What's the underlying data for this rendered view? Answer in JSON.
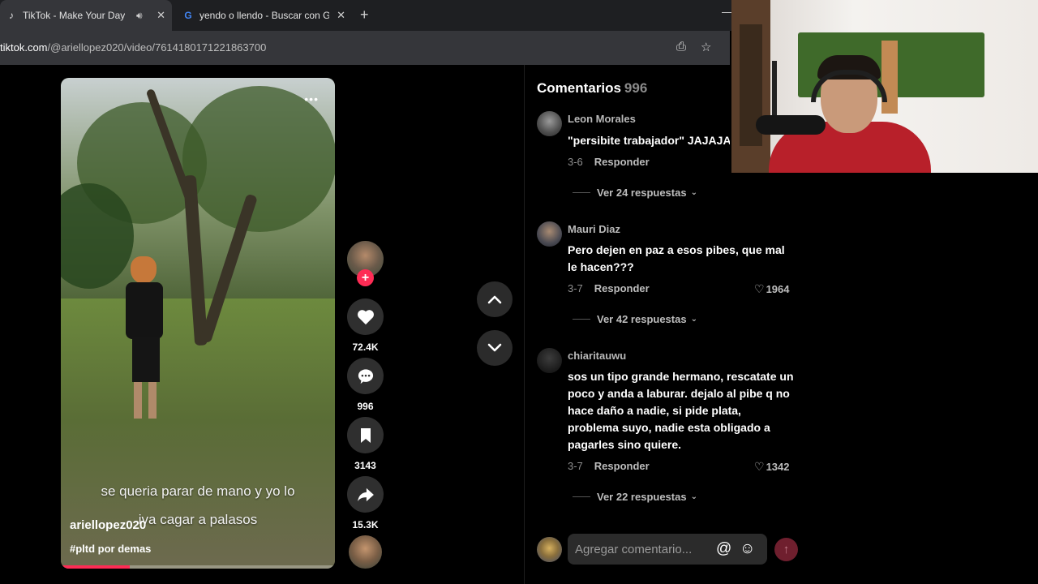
{
  "browser": {
    "tabs": [
      {
        "title": "TikTok - Make Your Day",
        "icon": "tiktok-icon"
      },
      {
        "title": "yendo o llendo - Buscar con Go",
        "icon": "google-icon"
      }
    ],
    "url_host": "tiktok.com",
    "url_path": "/@ariellopez020/video/7614180171221863700"
  },
  "video": {
    "caption_line1": "se queria parar de mano y yo lo",
    "caption_line2": "iva cagar a palasos",
    "username": "ariellopez020",
    "hashtag": "#pltd por demas",
    "progress": 0.25
  },
  "actions": {
    "likes": "72.4K",
    "comments": "996",
    "saves": "3143",
    "shares": "15.3K"
  },
  "comments_panel": {
    "title": "Comentarios",
    "count": "996",
    "comments": [
      {
        "user": "Leon Morales",
        "text": "\"persibite trabajador\" JAJAJA",
        "date": "3-6",
        "reply_label": "Responder",
        "likes": "",
        "view_replies": "Ver 24 respuestas"
      },
      {
        "user": "Mauri Diaz",
        "text": "Pero dejen en paz a esos pibes, que mal\nle hacen???",
        "date": "3-7",
        "reply_label": "Responder",
        "likes": "1964",
        "view_replies": "Ver 42 respuestas"
      },
      {
        "user": "chiaritauwu",
        "text": "sos un tipo grande hermano, rescatate un\npoco y anda a laburar. dejalo al pibe q no\nhace daño a nadie, si pide plata,\nproblema suyo, nadie esta obligado a\npagarles sino quiere.",
        "date": "3-7",
        "reply_label": "Responder",
        "likes": "1342",
        "view_replies": "Ver 22 respuestas"
      }
    ],
    "input_placeholder": "Agregar comentario..."
  },
  "colors": {
    "accent": "#fe2c55",
    "background": "#000000",
    "panel": "#2b2b2b"
  }
}
